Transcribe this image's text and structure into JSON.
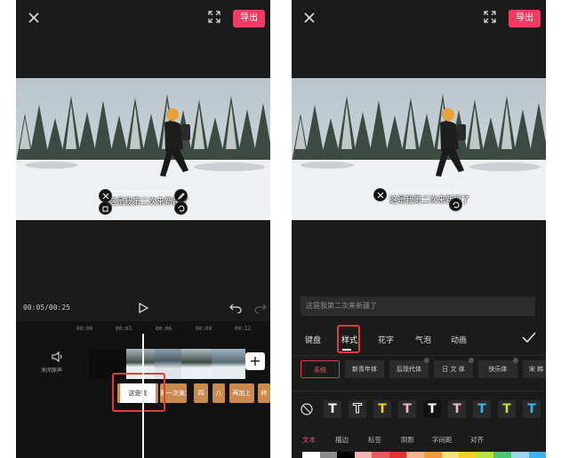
{
  "left": {
    "export_label": "导出",
    "subtitle": "这是我第二次来新疆了",
    "timecode": "00:05/00:25",
    "ticks": [
      "00:00",
      "00:03",
      "00:06",
      "00:09",
      "00:12"
    ],
    "mute_label": "关闭原声",
    "caption_clips": [
      {
        "label": "这是我",
        "selected": true
      },
      {
        "label": "第一次来主"
      },
      {
        "label": "四"
      },
      {
        "label": "八"
      },
      {
        "label": "再加上"
      },
      {
        "label": "终"
      }
    ]
  },
  "right": {
    "export_label": "导出",
    "subtitle": "这是我第二次来新疆了",
    "input_placeholder": "这是我第二次来新疆了",
    "tabs": [
      "键盘",
      "样式",
      "花字",
      "气泡",
      "动画"
    ],
    "active_tab": "样式",
    "fonts": [
      "系统",
      "新青年体",
      "后现代体",
      "日 文 体",
      "快乐体",
      "宋 韩"
    ],
    "active_font": "系统",
    "style_colors": [
      "#ffffff",
      "#ffffff",
      "#f2d22a",
      "#f3b6c8",
      "#ffffff",
      "#f3b6c8",
      "#3bb4f2",
      "#b9e23a",
      "#3bb4f2"
    ],
    "subtabs": [
      "文本",
      "描边",
      "标签",
      "阴影",
      "字间距",
      "对齐"
    ],
    "active_subtab": "文本",
    "palette": [
      "#ffffff",
      "#8c8c8c",
      "#000000",
      "#f3b6b6",
      "#e65b5b",
      "#e33131",
      "#f7b48a",
      "#f39a3b",
      "#f7e07a",
      "#f2d22a",
      "#b9e23a",
      "#4cc774",
      "#9ad7ee",
      "#3bb4f2"
    ]
  },
  "icons": {
    "close": "close-icon",
    "fullscreen": "fullscreen-icon",
    "play": "play-icon",
    "undo": "undo-icon",
    "redo": "redo-icon",
    "mute": "speaker-icon",
    "add": "plus-icon",
    "confirm": "check-icon",
    "no_style": "no-style-icon"
  },
  "colors": {
    "accent": "#f43a62",
    "highlight": "#e53a3a",
    "caption_clip": "#c88a4d",
    "background": "#1b1b1b"
  }
}
